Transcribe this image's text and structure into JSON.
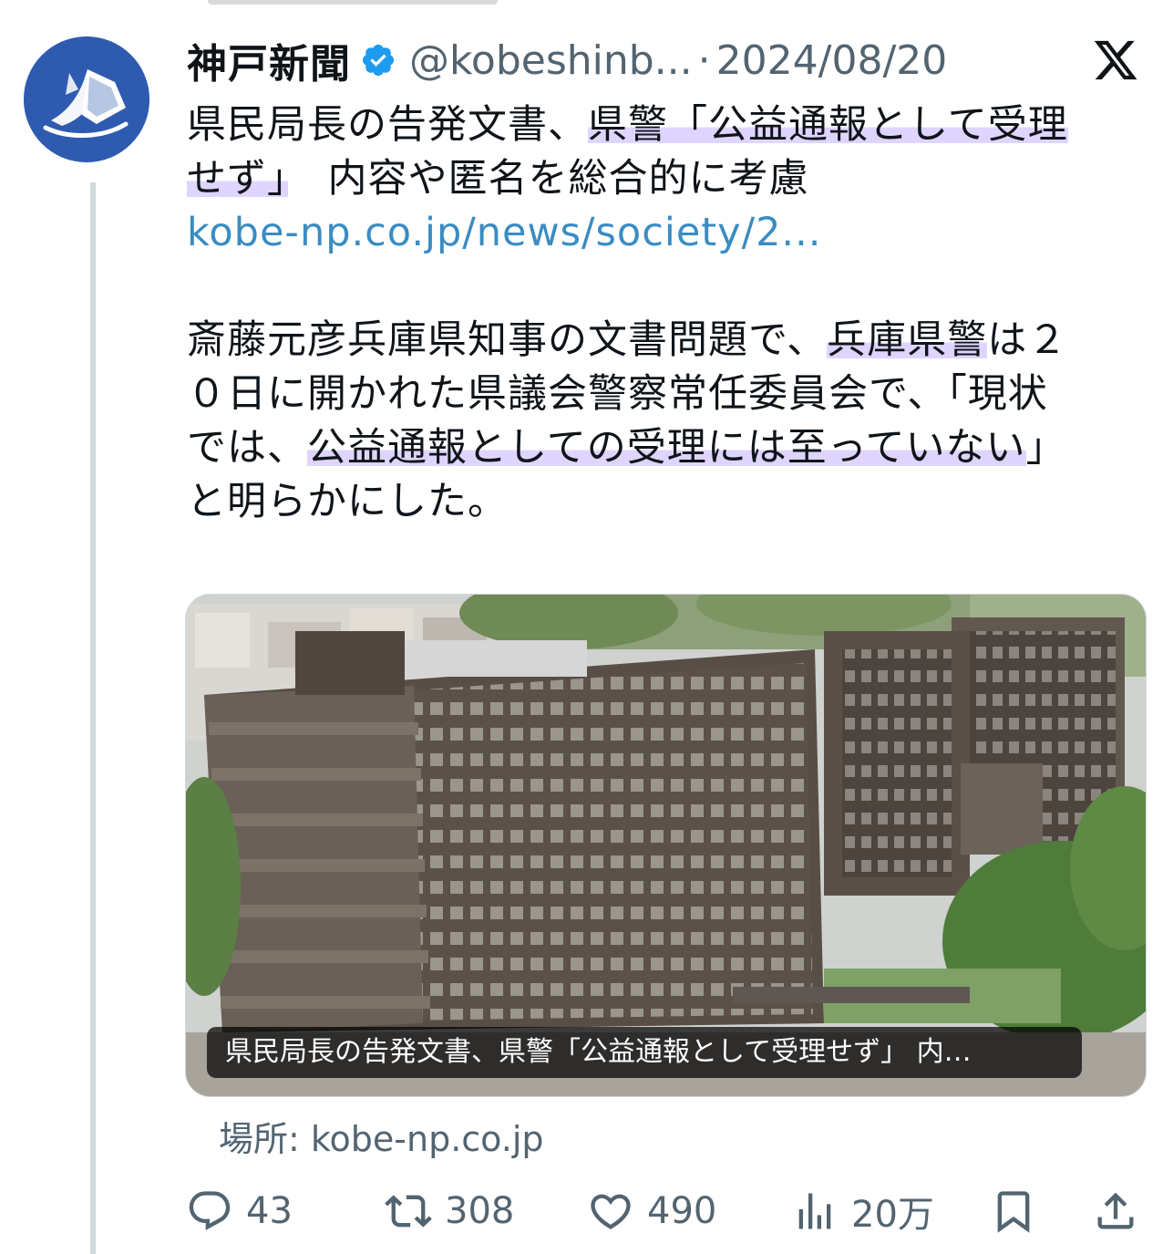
{
  "tweet": {
    "author": {
      "display_name": "神戸新聞",
      "handle": "@kobeshinb...",
      "verified_icon": "verified-badge-icon",
      "avatar_icon": "kobe-shimbun-logo"
    },
    "separator": "·",
    "timestamp": "2024/08/20",
    "platform_icon": "x-logo-icon",
    "text": {
      "line1_a": "県民局長の告発文書、",
      "line1_b": "県警「公益通報として受理",
      "line2_a": "せず」",
      "line2_b": "　内容や匿名を総合的に考慮",
      "link": "kobe-np.co.jp/news/society/2...",
      "para2_l1_a": "斎藤元彦兵庫県知事の文書問題で、",
      "para2_l1_b": "兵庫県警",
      "para2_l1_c": "は２",
      "para2_l2": "０日に開かれた県議会警察常任委員会で、「現状",
      "para2_l3_a": "では、",
      "para2_l3_b": "公益通報としての受理には至っていない",
      "para2_l3_c": "」",
      "para2_l4": "と明らかにした。"
    },
    "card": {
      "caption": "県民局長の告発文書、県警「公益通報として受理せず」 内…",
      "image": "hyogo-prefectural-office-photo"
    },
    "source": "場所: kobe-np.co.jp",
    "actions": {
      "reply": {
        "icon": "reply-icon",
        "count": "43"
      },
      "retweet": {
        "icon": "retweet-icon",
        "count": "308"
      },
      "like": {
        "icon": "heart-icon",
        "count": "490"
      },
      "views": {
        "icon": "views-icon",
        "count": "20万"
      },
      "bookmark": {
        "icon": "bookmark-icon"
      },
      "share": {
        "icon": "share-icon"
      }
    },
    "colors": {
      "verified": "#1d9bf0",
      "link": "#3a8cc2",
      "muted_text": "#536471",
      "highlight": "#c4b2ff",
      "avatar_bg": "#2e5bb0"
    }
  }
}
